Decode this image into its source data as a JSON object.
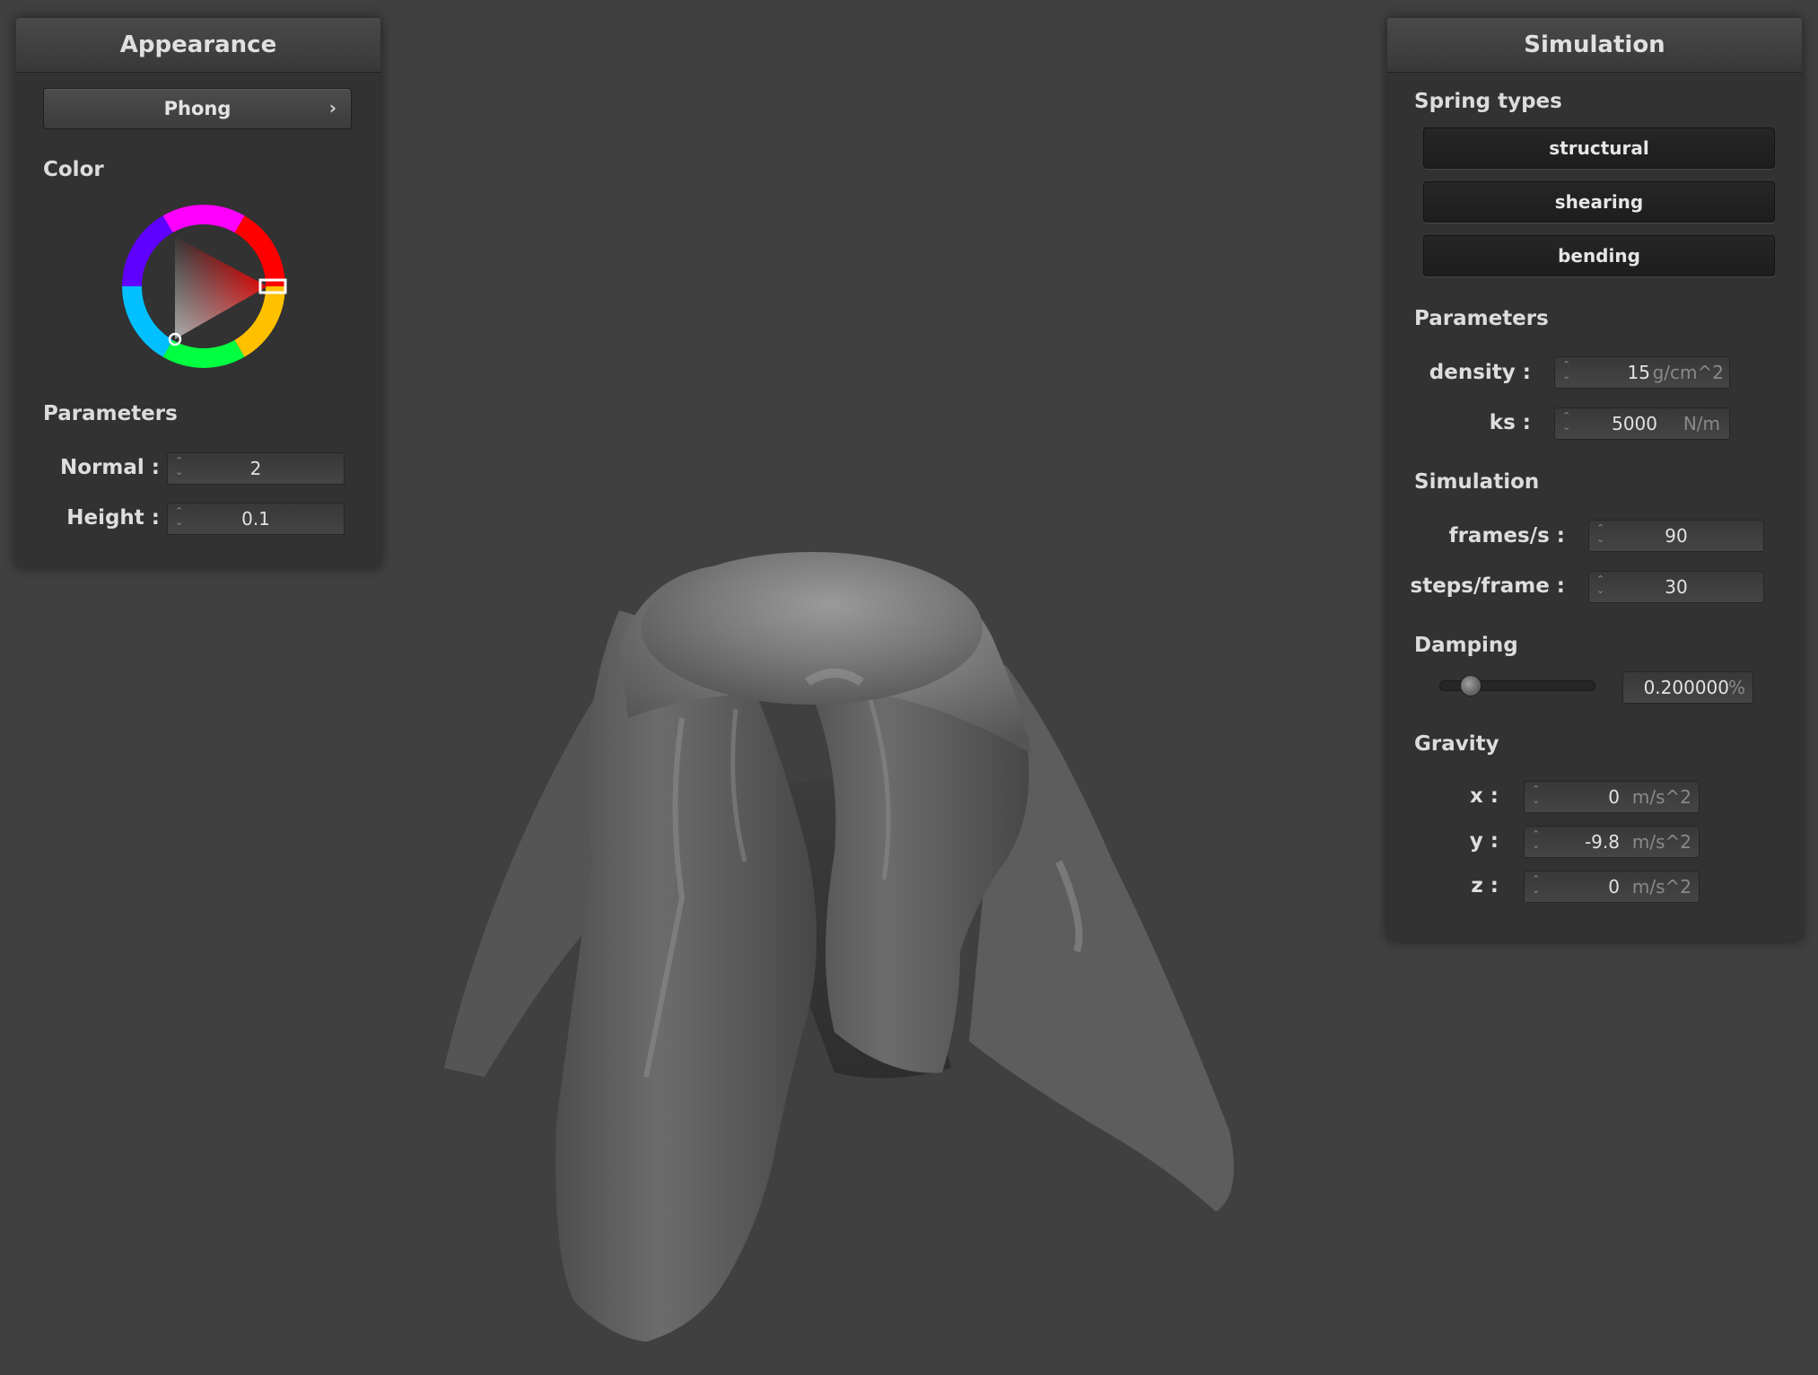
{
  "appearance": {
    "title": "Appearance",
    "shader_button": {
      "label": "Phong",
      "chevron": "›"
    },
    "color_label": "Color",
    "color_wheel": {
      "selected_hue": "#ff0000",
      "selected_color": "#1e1e1e"
    },
    "parameters_label": "Parameters",
    "normal": {
      "label": "Normal :",
      "value": "2"
    },
    "height": {
      "label": "Height :",
      "value": "0.1"
    }
  },
  "simulation": {
    "title": "Simulation",
    "spring_types_label": "Spring types",
    "spring_buttons": [
      {
        "label": "structural"
      },
      {
        "label": "shearing"
      },
      {
        "label": "bending"
      }
    ],
    "parameters_label": "Parameters",
    "density": {
      "label": "density :",
      "value": "15",
      "unit": "g/cm^2"
    },
    "ks": {
      "label": "ks :",
      "value": "5000",
      "unit": "N/m"
    },
    "simulation_label": "Simulation",
    "frames_per_s": {
      "label": "frames/s :",
      "value": "90"
    },
    "steps_per_frame": {
      "label": "steps/frame :",
      "value": "30"
    },
    "damping_label": "Damping",
    "damping": {
      "value": "0.200000",
      "unit": "%",
      "slider_fraction": 0.2
    },
    "gravity_label": "Gravity",
    "gravity_x": {
      "label": "x :",
      "value": "0",
      "unit": "m/s^2"
    },
    "gravity_y": {
      "label": "y :",
      "value": "-9.8",
      "unit": "m/s^2"
    },
    "gravity_z": {
      "label": "z :",
      "value": "0",
      "unit": "m/s^2"
    }
  },
  "viewport": {
    "background": "#404040",
    "cloth_color": "#6e6e6e",
    "content": "cloth draped over sphere"
  }
}
